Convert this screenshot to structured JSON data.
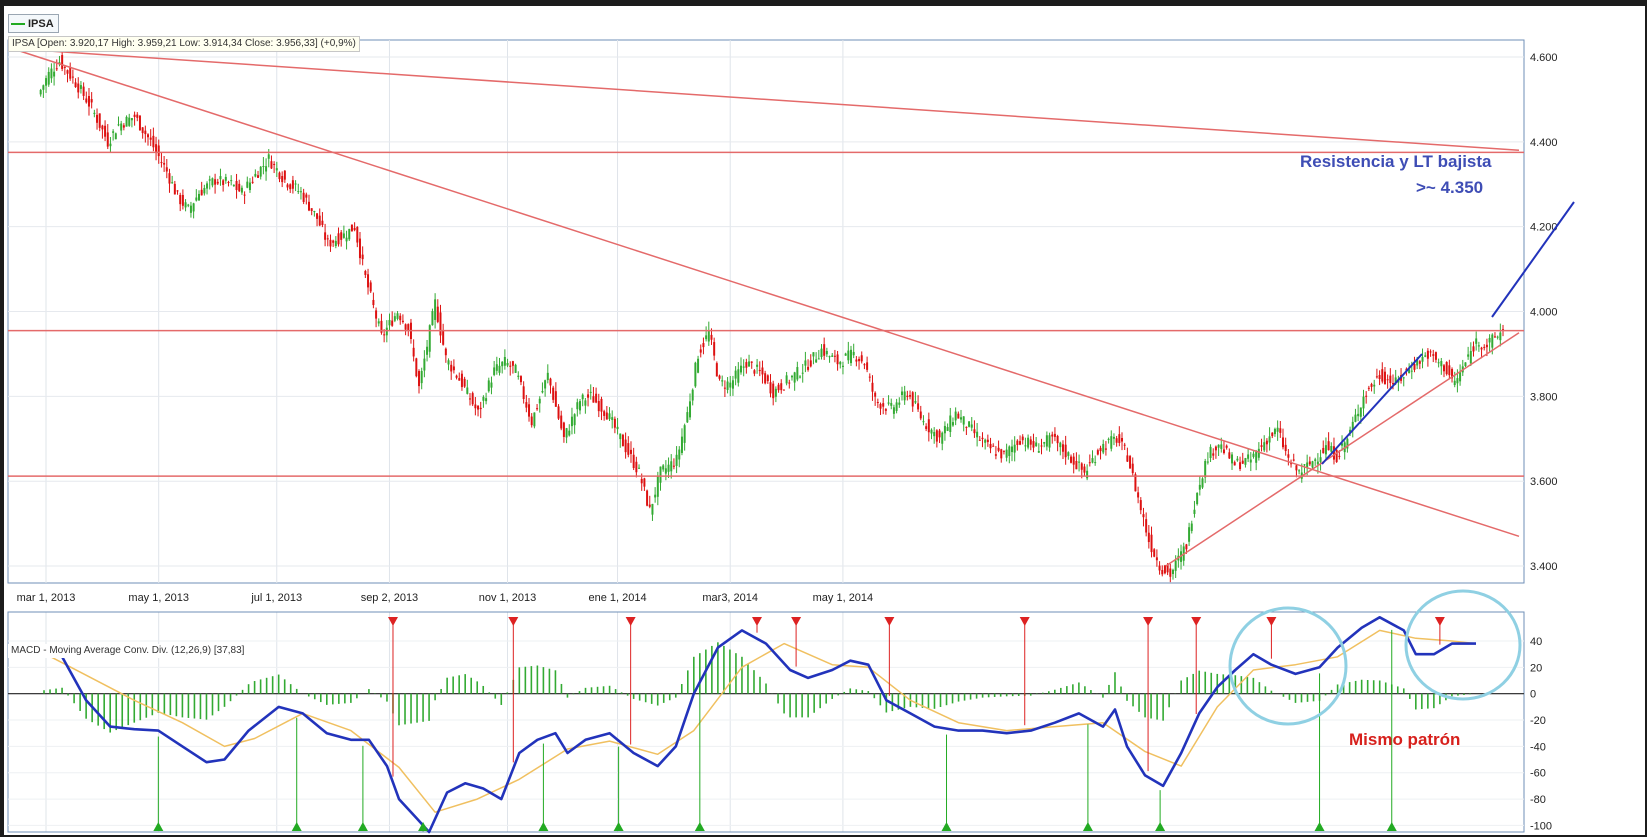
{
  "legend": {
    "label": "IPSA"
  },
  "info": {
    "text": "IPSA [Open: 3.920,17  High: 3.959,21  Low: 3.914,34  Close: 3.956,33] (+0,9%)"
  },
  "macd": {
    "label": "MACD - Moving Average Conv. Div. (12,26,9) [37,83]"
  },
  "annotations": {
    "resistance_line1": "Resistencia y LT bajista",
    "resistance_line2": ">~ 4.350",
    "pattern": "Mismo patrón"
  },
  "colors": {
    "up_candle": "#33aa33",
    "down_candle": "#dd1111",
    "trend_line": "#e46a6a",
    "macd_line": "#2233bb",
    "signal_line": "#f0c060",
    "histogram": "#33aa33",
    "circle": "#8fd0e3",
    "annotation_blue": "#3e4db5",
    "annotation_red": "#d7201c"
  },
  "chart_data": [
    {
      "type": "candlestick",
      "series_name": "IPSA",
      "x_ticks": [
        "mar 1, 2013",
        "may 1, 2013",
        "jul 1, 2013",
        "sep 2, 2013",
        "nov 1, 2013",
        "ene 1, 2014",
        "mar3, 2014",
        "may 1, 2014"
      ],
      "y_ticks": [
        "4.600",
        "4.400",
        "4.200",
        "4.000",
        "3.800",
        "3.600",
        "3.400"
      ],
      "ylim": [
        3360,
        4640
      ],
      "close_path": [
        [
          0,
          4510
        ],
        [
          4,
          4560
        ],
        [
          8,
          4590
        ],
        [
          14,
          4540
        ],
        [
          20,
          4480
        ],
        [
          26,
          4400
        ],
        [
          30,
          4440
        ],
        [
          36,
          4460
        ],
        [
          42,
          4400
        ],
        [
          48,
          4330
        ],
        [
          52,
          4270
        ],
        [
          56,
          4240
        ],
        [
          60,
          4280
        ],
        [
          66,
          4310
        ],
        [
          72,
          4300
        ],
        [
          76,
          4280
        ],
        [
          82,
          4330
        ],
        [
          86,
          4360
        ],
        [
          92,
          4310
        ],
        [
          98,
          4280
        ],
        [
          104,
          4220
        ],
        [
          108,
          4160
        ],
        [
          114,
          4180
        ],
        [
          118,
          4200
        ],
        [
          122,
          4080
        ],
        [
          128,
          3940
        ],
        [
          134,
          4000
        ],
        [
          138,
          3960
        ],
        [
          142,
          3820
        ],
        [
          148,
          4020
        ],
        [
          152,
          3890
        ],
        [
          158,
          3830
        ],
        [
          164,
          3760
        ],
        [
          170,
          3860
        ],
        [
          174,
          3880
        ],
        [
          178,
          3860
        ],
        [
          184,
          3740
        ],
        [
          190,
          3850
        ],
        [
          196,
          3700
        ],
        [
          202,
          3790
        ],
        [
          206,
          3800
        ],
        [
          212,
          3760
        ],
        [
          218,
          3690
        ],
        [
          224,
          3620
        ],
        [
          228,
          3530
        ],
        [
          232,
          3620
        ],
        [
          238,
          3650
        ],
        [
          242,
          3760
        ],
        [
          246,
          3900
        ],
        [
          250,
          3950
        ],
        [
          254,
          3830
        ],
        [
          258,
          3830
        ],
        [
          264,
          3880
        ],
        [
          270,
          3850
        ],
        [
          274,
          3810
        ],
        [
          278,
          3830
        ],
        [
          286,
          3870
        ],
        [
          292,
          3910
        ],
        [
          298,
          3880
        ],
        [
          304,
          3900
        ],
        [
          308,
          3880
        ],
        [
          312,
          3790
        ],
        [
          318,
          3770
        ],
        [
          324,
          3810
        ],
        [
          330,
          3740
        ],
        [
          336,
          3700
        ],
        [
          342,
          3760
        ],
        [
          348,
          3720
        ],
        [
          354,
          3680
        ],
        [
          360,
          3660
        ],
        [
          366,
          3700
        ],
        [
          372,
          3680
        ],
        [
          378,
          3700
        ],
        [
          384,
          3660
        ],
        [
          390,
          3620
        ],
        [
          396,
          3680
        ],
        [
          402,
          3700
        ],
        [
          406,
          3660
        ],
        [
          410,
          3560
        ],
        [
          414,
          3460
        ],
        [
          418,
          3400
        ],
        [
          422,
          3380
        ],
        [
          428,
          3450
        ],
        [
          432,
          3580
        ],
        [
          436,
          3660
        ],
        [
          440,
          3690
        ],
        [
          446,
          3640
        ],
        [
          452,
          3650
        ],
        [
          458,
          3700
        ],
        [
          462,
          3720
        ],
        [
          466,
          3650
        ],
        [
          470,
          3620
        ],
        [
          474,
          3640
        ],
        [
          480,
          3680
        ],
        [
          484,
          3660
        ],
        [
          488,
          3700
        ],
        [
          494,
          3800
        ],
        [
          500,
          3850
        ],
        [
          506,
          3830
        ],
        [
          512,
          3870
        ],
        [
          518,
          3900
        ],
        [
          524,
          3870
        ],
        [
          528,
          3830
        ],
        [
          532,
          3880
        ],
        [
          536,
          3930
        ],
        [
          540,
          3920
        ],
        [
          546,
          3956
        ]
      ],
      "trend_lines": [
        {
          "from": [
            0,
            4620
          ],
          "to": [
            565,
            4380
          ]
        },
        {
          "from": [
            0,
            4620
          ],
          "to": [
            565,
            3470
          ]
        },
        {
          "from": [
            430,
            3400
          ],
          "to": [
            565,
            3950
          ]
        }
      ],
      "horizontal_lines": [
        4375,
        3955,
        3612
      ],
      "notes": "x in trading-day index from mar 1, 2013 to may 2014"
    },
    {
      "type": "macd",
      "series_name": "MACD - Moving Average Conv. Div. (12,26,9)",
      "y_ticks": [
        "40",
        "20",
        "0",
        "-20",
        "-40",
        "-60",
        "-80",
        "-100"
      ],
      "ylim": [
        -105,
        62
      ],
      "macd_path": [
        [
          0,
          35
        ],
        [
          8,
          28
        ],
        [
          16,
          -5
        ],
        [
          24,
          -25
        ],
        [
          32,
          -27
        ],
        [
          40,
          -28
        ],
        [
          48,
          -40
        ],
        [
          56,
          -52
        ],
        [
          62,
          -50
        ],
        [
          70,
          -28
        ],
        [
          80,
          -10
        ],
        [
          88,
          -15
        ],
        [
          96,
          -30
        ],
        [
          104,
          -35
        ],
        [
          110,
          -35
        ],
        [
          116,
          -55
        ],
        [
          120,
          -80
        ],
        [
          126,
          -95
        ],
        [
          130,
          -105
        ],
        [
          136,
          -75
        ],
        [
          142,
          -68
        ],
        [
          148,
          -72
        ],
        [
          154,
          -80
        ],
        [
          160,
          -45
        ],
        [
          166,
          -35
        ],
        [
          172,
          -30
        ],
        [
          176,
          -45
        ],
        [
          182,
          -35
        ],
        [
          190,
          -30
        ],
        [
          198,
          -45
        ],
        [
          206,
          -55
        ],
        [
          212,
          -40
        ],
        [
          218,
          0
        ],
        [
          226,
          35
        ],
        [
          234,
          48
        ],
        [
          242,
          38
        ],
        [
          250,
          18
        ],
        [
          256,
          12
        ],
        [
          264,
          18
        ],
        [
          270,
          25
        ],
        [
          276,
          22
        ],
        [
          282,
          -5
        ],
        [
          290,
          -15
        ],
        [
          298,
          -25
        ],
        [
          306,
          -28
        ],
        [
          314,
          -28
        ],
        [
          322,
          -30
        ],
        [
          330,
          -28
        ],
        [
          338,
          -22
        ],
        [
          346,
          -15
        ],
        [
          354,
          -25
        ],
        [
          358,
          -12
        ],
        [
          362,
          -40
        ],
        [
          368,
          -62
        ],
        [
          374,
          -70
        ],
        [
          380,
          -45
        ],
        [
          386,
          -15
        ],
        [
          392,
          5
        ],
        [
          398,
          18
        ],
        [
          404,
          30
        ],
        [
          410,
          22
        ],
        [
          418,
          15
        ],
        [
          426,
          20
        ],
        [
          432,
          35
        ],
        [
          440,
          50
        ],
        [
          446,
          58
        ],
        [
          454,
          48
        ],
        [
          458,
          30
        ],
        [
          464,
          30
        ],
        [
          470,
          38
        ],
        [
          478,
          38
        ]
      ],
      "signal_path": [
        [
          0,
          33
        ],
        [
          16,
          14
        ],
        [
          32,
          -5
        ],
        [
          48,
          -22
        ],
        [
          62,
          -40
        ],
        [
          72,
          -34
        ],
        [
          88,
          -15
        ],
        [
          104,
          -28
        ],
        [
          120,
          -56
        ],
        [
          132,
          -90
        ],
        [
          146,
          -80
        ],
        [
          160,
          -65
        ],
        [
          176,
          -42
        ],
        [
          190,
          -36
        ],
        [
          206,
          -46
        ],
        [
          218,
          -28
        ],
        [
          234,
          20
        ],
        [
          248,
          38
        ],
        [
          264,
          22
        ],
        [
          276,
          20
        ],
        [
          290,
          -5
        ],
        [
          306,
          -22
        ],
        [
          322,
          -28
        ],
        [
          338,
          -25
        ],
        [
          354,
          -22
        ],
        [
          368,
          -44
        ],
        [
          380,
          -55
        ],
        [
          392,
          -10
        ],
        [
          404,
          18
        ],
        [
          418,
          22
        ],
        [
          432,
          28
        ],
        [
          446,
          48
        ],
        [
          458,
          42
        ],
        [
          470,
          40
        ],
        [
          478,
          38
        ]
      ],
      "sell_markers_x": [
        118,
        158,
        197,
        239,
        252,
        283,
        328,
        369,
        385,
        410,
        466
      ],
      "buy_markers_x": [
        40,
        86,
        108,
        128,
        168,
        193,
        220,
        302,
        349,
        373,
        426,
        450
      ],
      "notes": "x positions in chart index aligned to price panel"
    }
  ]
}
